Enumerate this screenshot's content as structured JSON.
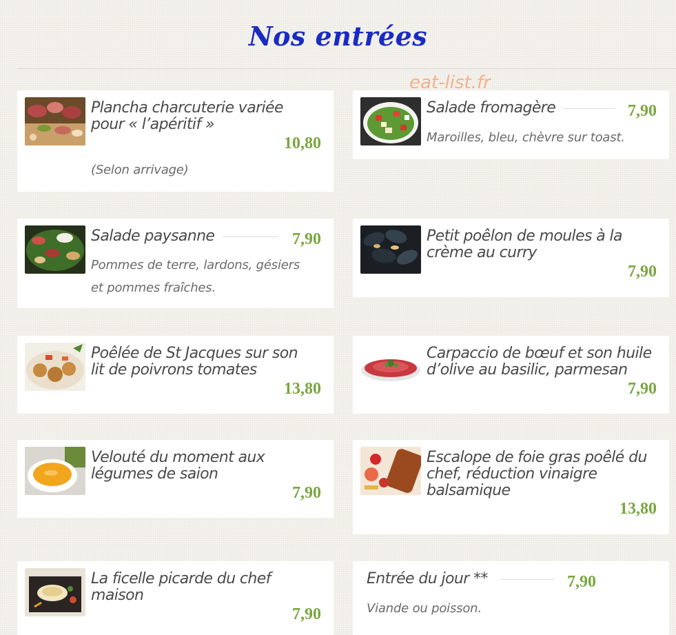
{
  "page": {
    "title": "Nos entrées",
    "watermark": "eat-list.fr"
  },
  "colors": {
    "title": "#1a2bc4",
    "price": "#79a63f",
    "watermark": "#f5b08c",
    "card": "#ffffff"
  },
  "items": [
    {
      "name_lines": [
        "Plancha charcuterie variée",
        "pour « l’apéritif »"
      ],
      "price": "10,80",
      "desc_lines": [
        "(Selon arrivage)"
      ],
      "image": "charcuterie-platter"
    },
    {
      "name_lines": [
        "Salade fromagère"
      ],
      "price": "7,90",
      "desc_lines": [
        "Maroilles, bleu, chèvre sur toast."
      ],
      "image": "cheese-salad"
    },
    {
      "name_lines": [
        "Salade paysanne"
      ],
      "price": "7,90",
      "desc_lines": [
        "Pommes de terre, lardons, gésiers",
        "et pommes fraîches."
      ],
      "image": "country-salad"
    },
    {
      "name_lines": [
        "Petit poêlon de moules à la",
        "crème au curry"
      ],
      "price": "7,90",
      "desc_lines": [],
      "image": "mussels"
    },
    {
      "name_lines": [
        "Poêlée de St Jacques sur son",
        "lit de poivrons tomates"
      ],
      "price": "13,80",
      "desc_lines": [],
      "image": "scallops"
    },
    {
      "name_lines": [
        "Carpaccio de bœuf et son huile",
        "d’olive au basilic, parmesan"
      ],
      "price": "7,90",
      "desc_lines": [],
      "image": "beef-carpaccio"
    },
    {
      "name_lines": [
        "Velouté du moment aux",
        "légumes de saion"
      ],
      "price": "7,90",
      "desc_lines": [],
      "image": "veloute-soup"
    },
    {
      "name_lines": [
        "Escalope de foie gras poêlé du",
        "chef, réduction vinaigre",
        "balsamique"
      ],
      "price": "13,80",
      "desc_lines": [],
      "image": "foie-gras"
    },
    {
      "name_lines": [
        "La ficelle picarde du chef",
        "maison"
      ],
      "price": "7,90",
      "desc_lines": [],
      "image": "ficelle-picarde"
    },
    {
      "name_lines": [
        "Entrée du jour **"
      ],
      "price": "7,90",
      "desc_lines": [
        "Viande ou poisson."
      ],
      "image": ""
    }
  ]
}
